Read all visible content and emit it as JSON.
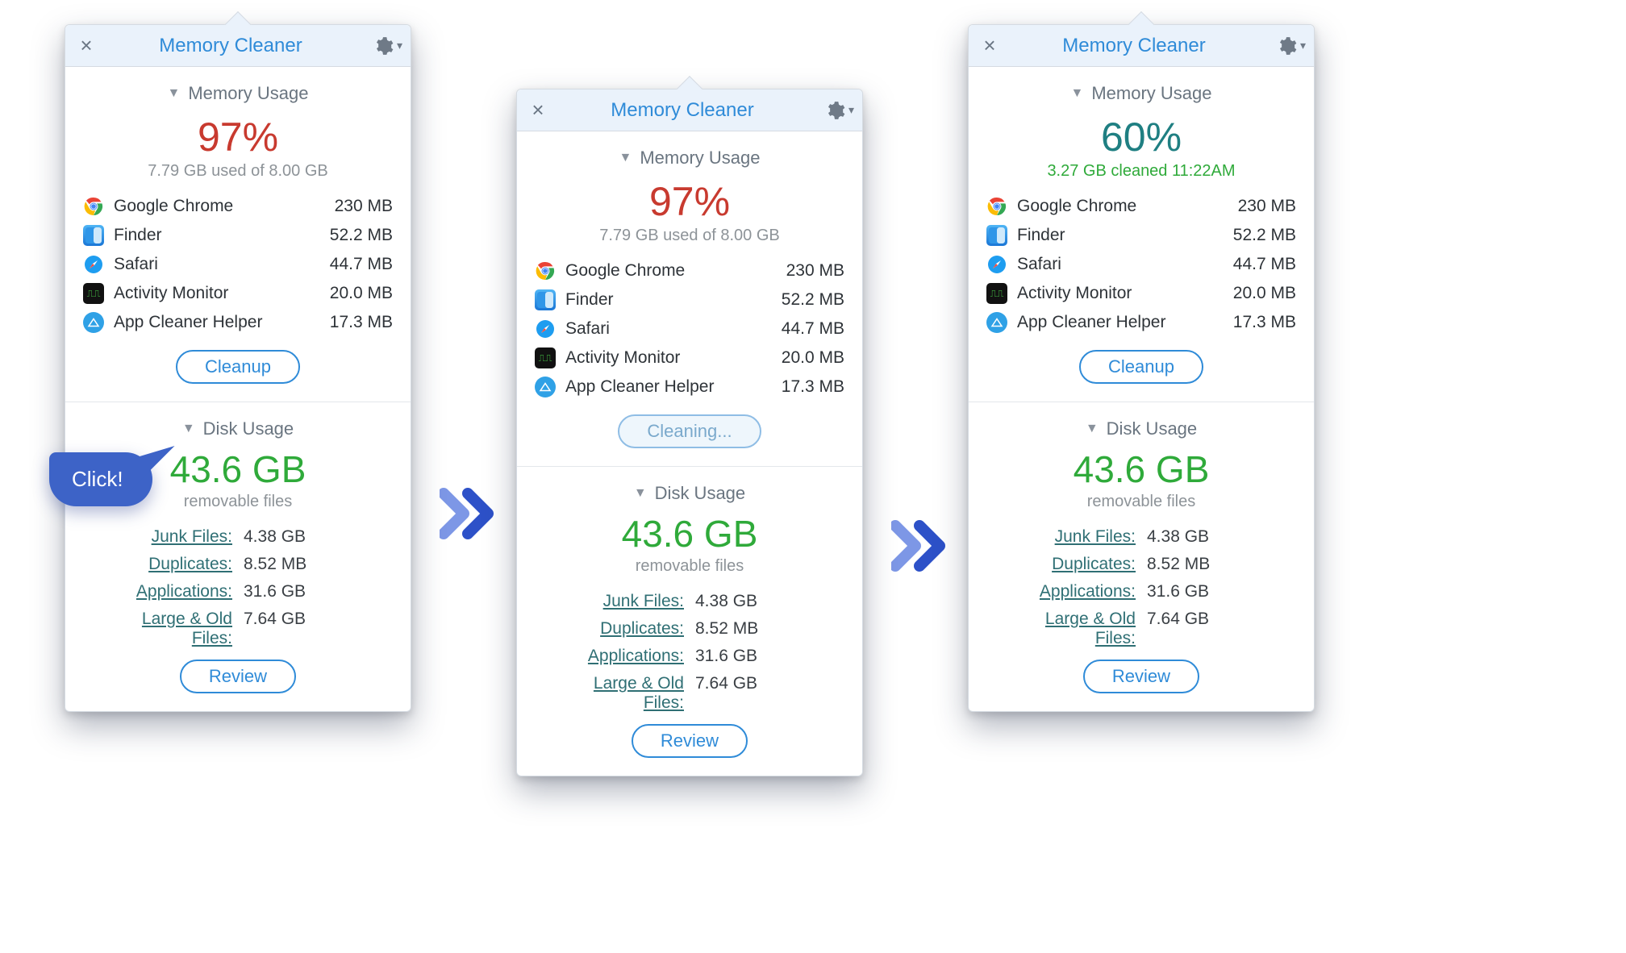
{
  "common": {
    "title": "Memory Cleaner",
    "mem_section": "Memory Usage",
    "disk_section": "Disk Usage",
    "review_label": "Review",
    "removable_label": "removable files",
    "apps": [
      {
        "name": "Google Chrome",
        "size": "230 MB"
      },
      {
        "name": "Finder",
        "size": "52.2 MB"
      },
      {
        "name": "Safari",
        "size": "44.7 MB"
      },
      {
        "name": "Activity Monitor",
        "size": "20.0 MB"
      },
      {
        "name": "App Cleaner Helper",
        "size": "17.3 MB"
      }
    ],
    "disk_total": "43.6 GB",
    "files": [
      {
        "label": "Junk Files:",
        "value": "4.38 GB"
      },
      {
        "label": "Duplicates:",
        "value": "8.52 MB"
      },
      {
        "label": "Applications:",
        "value": "31.6 GB"
      },
      {
        "label": "Large & Old Files:",
        "value": "7.64 GB"
      }
    ]
  },
  "panel1": {
    "pct": "97%",
    "sub": "7.79 GB used of 8.00 GB",
    "btn": "Cleanup",
    "bubble": "Click!"
  },
  "panel2": {
    "pct": "97%",
    "sub": "7.79 GB used of 8.00 GB",
    "btn": "Cleaning..."
  },
  "panel3": {
    "pct": "60%",
    "sub": "3.27 GB cleaned 11:22AM",
    "btn": "Cleanup"
  }
}
